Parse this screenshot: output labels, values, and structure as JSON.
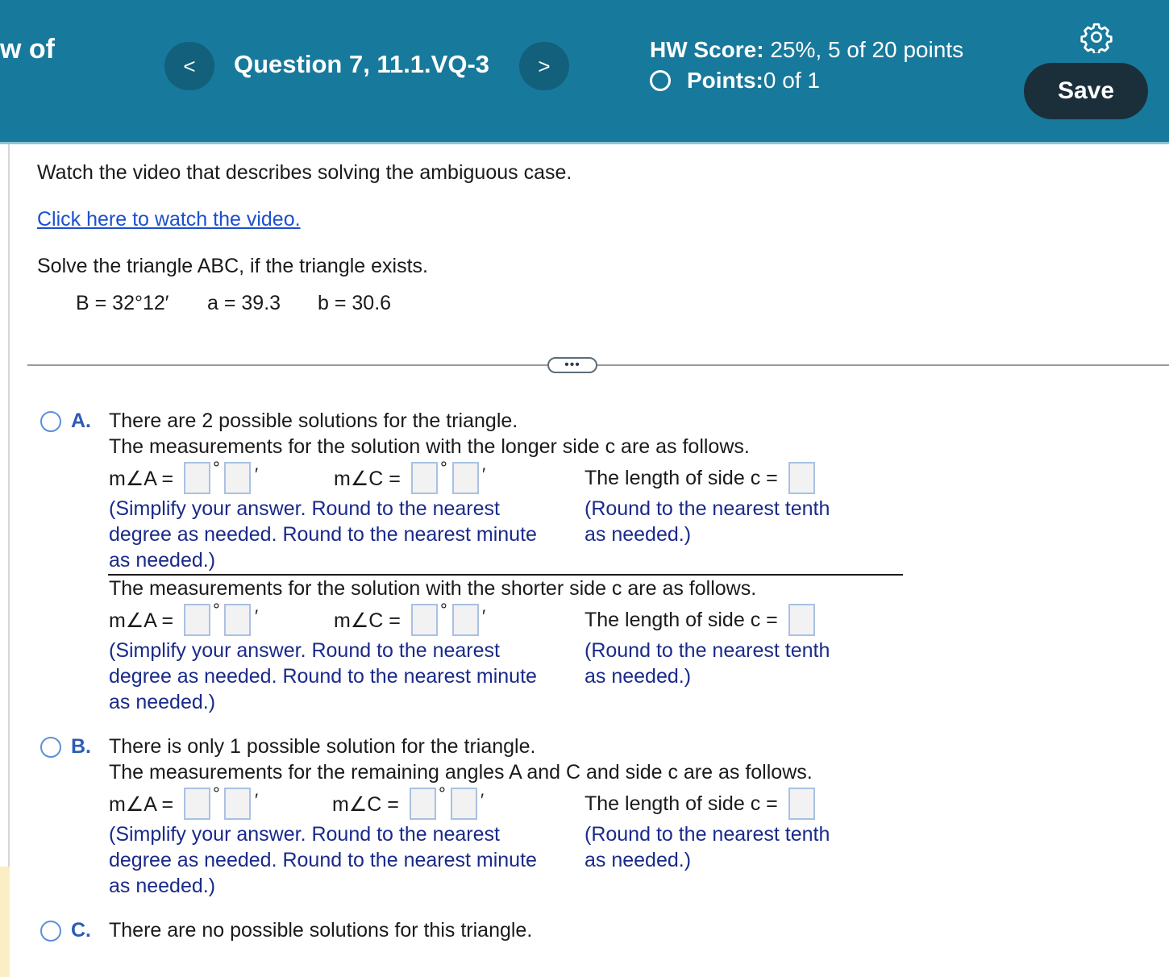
{
  "header": {
    "clipped_text": "w of",
    "prev_label": "<",
    "next_label": ">",
    "question_title": "Question 7, 11.1.VQ-3",
    "score_label": "HW Score:",
    "score_value": " 25%, 5 of 20 points",
    "points_label": "Points:",
    "points_value": " 0 of 1",
    "save_label": "Save",
    "settings_icon": "gear-icon"
  },
  "problem": {
    "intro": "Watch the video that describes solving the ambiguous case.",
    "video_link": "Click here to watch the video.",
    "instruction": "Solve the triangle ABC, if the triangle exists.",
    "given_B": "B = 32°12′",
    "given_a": "a = 39.3",
    "given_b": "b = 30.6"
  },
  "more_button": "•••",
  "labels": {
    "angle_A": "m∠A =",
    "angle_C": "m∠C =",
    "side_c": "The length of side c =",
    "degree_symbol": "°",
    "minute_symbol": "′"
  },
  "hints": {
    "angle_hint": [
      "(Simplify your answer. Round to the nearest",
      "degree as needed. Round to the nearest minute",
      "as needed.)"
    ],
    "side_hint": [
      "(Round to the nearest tenth",
      "as needed.)"
    ]
  },
  "options": {
    "A": {
      "letter": "A.",
      "line1": "There are 2 possible solutions for the triangle.",
      "longer": "The measurements for the solution with the longer side c are as follows.",
      "shorter": "The measurements for the solution with the shorter side c are as follows."
    },
    "B": {
      "letter": "B.",
      "line1": "There is only 1 possible solution for the triangle.",
      "line2": "The measurements for the remaining angles A and C and side c are as follows."
    },
    "C": {
      "letter": "C.",
      "line1": "There are no possible solutions for this triangle."
    }
  }
}
